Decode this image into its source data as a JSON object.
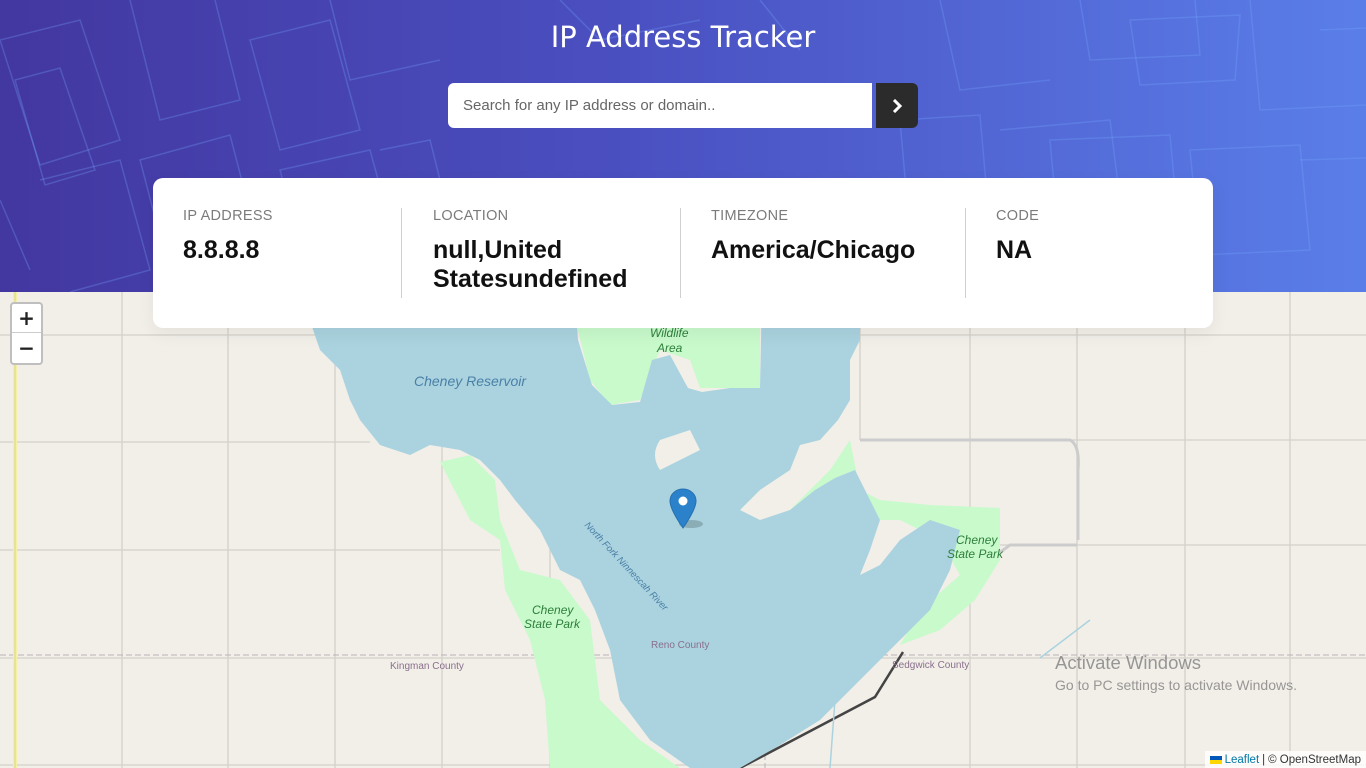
{
  "header": {
    "title": "IP Address Tracker",
    "search": {
      "placeholder": "Search for any IP address or domain..",
      "value": ""
    },
    "submit_icon": "chevron-right-icon"
  },
  "info": {
    "ip": {
      "label": "IP ADDRESS",
      "value": "8.8.8.8"
    },
    "location": {
      "label": "LOCATION",
      "value_line1": "null,United",
      "value_line2": "Statesundefined"
    },
    "timezone": {
      "label": "TIMEZONE",
      "value": "America/Chicago"
    },
    "code": {
      "label": "CODE",
      "value": "NA"
    }
  },
  "map": {
    "zoom_in": "+",
    "zoom_out": "−",
    "marker_icon": "map-pin-icon",
    "labels": {
      "wildlife": "Wildlife",
      "area": "Area",
      "reservoir": "Cheney Reservoir",
      "river": "North Fork Ninnescah River",
      "park_east_1": "Cheney",
      "park_east_2": "State Park",
      "park_west_1": "Cheney",
      "park_west_2": "State Park",
      "reno": "Reno County",
      "kingman": "Kingman County",
      "sedgwick": "Sedgwick County"
    },
    "attribution": {
      "leaflet": "Leaflet",
      "separator": "|",
      "osm": "© OpenStreetMap"
    }
  },
  "watermark": {
    "title": "Activate Windows",
    "subtitle": "Go to PC settings to activate Windows."
  },
  "colors": {
    "header_start": "#4337a0",
    "header_end": "#5a7ee8",
    "water": "#aad3df",
    "park": "#c8facc",
    "land": "#f2efe9",
    "marker": "#2b82cb"
  }
}
